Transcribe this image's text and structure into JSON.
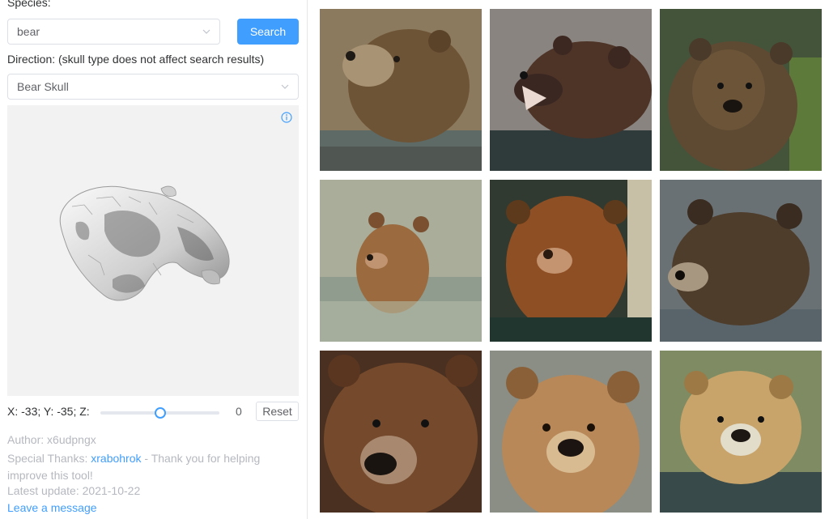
{
  "species": {
    "label": "Species:",
    "value": "bear",
    "search_button": "Search"
  },
  "direction": {
    "label": "Direction: (skull type does not affect search results)",
    "value": "Bear Skull"
  },
  "viewer": {
    "info_icon": "info-icon",
    "coords": "X: -33; Y: -35; Z:",
    "slider_value": "0",
    "slider_level": 0.5,
    "reset_button": "Reset"
  },
  "footer": {
    "author": "Author: x6udpngx",
    "thanks_prefix": "Special Thanks: ",
    "thanks_link": "xrabohrok",
    "thanks_suffix": " - Thank you for helping improve this tool!",
    "update": "Latest update: 2021-10-22",
    "leave_message": "Leave a message"
  },
  "results": {
    "images": [
      {
        "subject": "brown bear in water, looking up"
      },
      {
        "subject": "brown bear roaring in water"
      },
      {
        "subject": "brown bear in forest"
      },
      {
        "subject": "brown bear swimming"
      },
      {
        "subject": "brown bear dripping wet"
      },
      {
        "subject": "dark brown bear in water"
      },
      {
        "subject": "brown bear close-up"
      },
      {
        "subject": "light brown bear portrait"
      },
      {
        "subject": "blonde bear in water"
      }
    ]
  },
  "colors": {
    "accent": "#409eff",
    "border": "#dcdfe6",
    "muted": "#b5b8bf"
  }
}
